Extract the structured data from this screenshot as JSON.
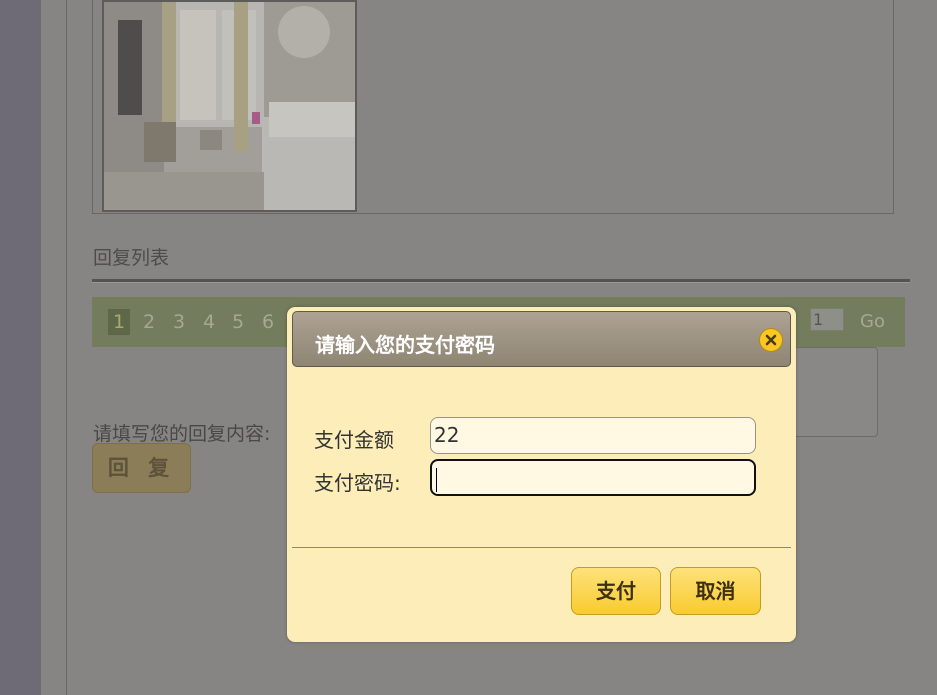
{
  "background_page": {
    "reply_list_title": "回复列表",
    "pager": {
      "pages": [
        "1",
        "2",
        "3",
        "4",
        "5",
        "6"
      ],
      "active_page": "1",
      "jump_value": "1",
      "go_label": "Go"
    },
    "reply_prompt_label": "请填写您的回复内容:",
    "reply_button_label": "回 复"
  },
  "payment_dialog": {
    "title": "请输入您的支付密码",
    "amount_label": "支付金额",
    "amount_value": "22",
    "password_label": "支付密码:",
    "password_value": "",
    "pay_button_label": "支付",
    "cancel_button_label": "取消"
  },
  "colors": {
    "overlay": "#878583",
    "dialog_background": "#fdedb9",
    "dialog_header": "#9d9383",
    "button_accent": "#f9cb2f"
  },
  "icons": {
    "close": "close-icon"
  }
}
